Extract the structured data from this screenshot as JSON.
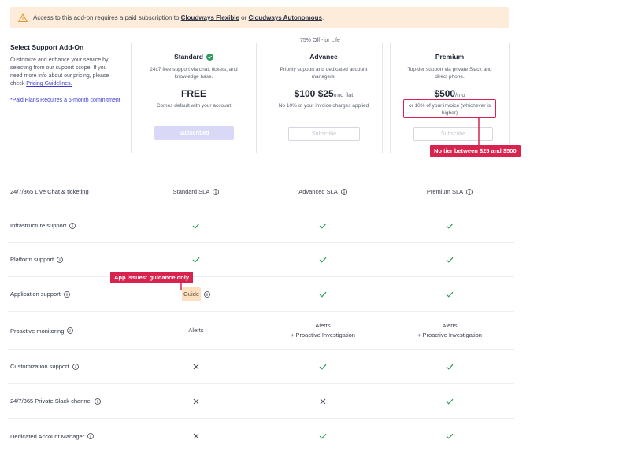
{
  "banner": {
    "text_before": "Access to this add-on requires a paid subscription to",
    "link1": "Cloudways Flexible",
    "text_mid": "or",
    "link2": "Cloudways Autonomous",
    "text_after": "."
  },
  "intro": {
    "title": "Select Support Add-On",
    "body": "Customize and enhance your service by selecting from our support scope. If you need more info about our pricing, please check",
    "link": "Pricing Guidelines.",
    "note": "*Paid Plans Requires a 6-month commitment"
  },
  "plans": {
    "standard": {
      "name": "Standard",
      "desc": "24x7 free support via chat, tickets, and knowledge base.",
      "price": "FREE",
      "sub": "Comes default with your account",
      "button": "Subscribed"
    },
    "advance": {
      "badge": "75% Off -for Life",
      "name": "Advance",
      "desc": "Priority support and dedicated account managers.",
      "old_price": "$100",
      "price": "$25",
      "unit": "/mo flat",
      "sub": "No 10% of your invoice charges applied",
      "button": "Subscribe"
    },
    "premium": {
      "name": "Premium",
      "desc": "Top-tier support via private Slack and direct phone.",
      "price": "$500",
      "unit": "/mo",
      "sub": "or 10% of your invoice (whichever is higher)",
      "button": "Subscribe"
    }
  },
  "annotations": {
    "tier_gap": "No tier between $25 and $500",
    "app_issues": "App issues: guidance only"
  },
  "features": {
    "sla": {
      "label": "24/7/365 Live Chat & ticketing",
      "standard": "Standard SLA",
      "advance": "Advanced SLA",
      "premium": "Premium SLA"
    },
    "infra": {
      "label": "Infrastructure support"
    },
    "platform": {
      "label": "Platform support"
    },
    "application": {
      "label": "Application support",
      "standard": "Guide"
    },
    "monitoring": {
      "label": "Proactive monitoring",
      "standard": "Alerts",
      "advance": "Alerts",
      "advance2": "+ Proactive Investigation",
      "premium": "Alerts",
      "premium2": "+ Proactive Investigation"
    },
    "customization": {
      "label": "Customization support"
    },
    "slack": {
      "label": "24/7/365 Private Slack channel"
    },
    "manager": {
      "label": "Dedicated Account Manager"
    }
  },
  "colors": {
    "accent": "#d9234f",
    "link": "#3a3ad1",
    "check": "#2e9a5c",
    "banner_bg": "#fdecd9"
  }
}
